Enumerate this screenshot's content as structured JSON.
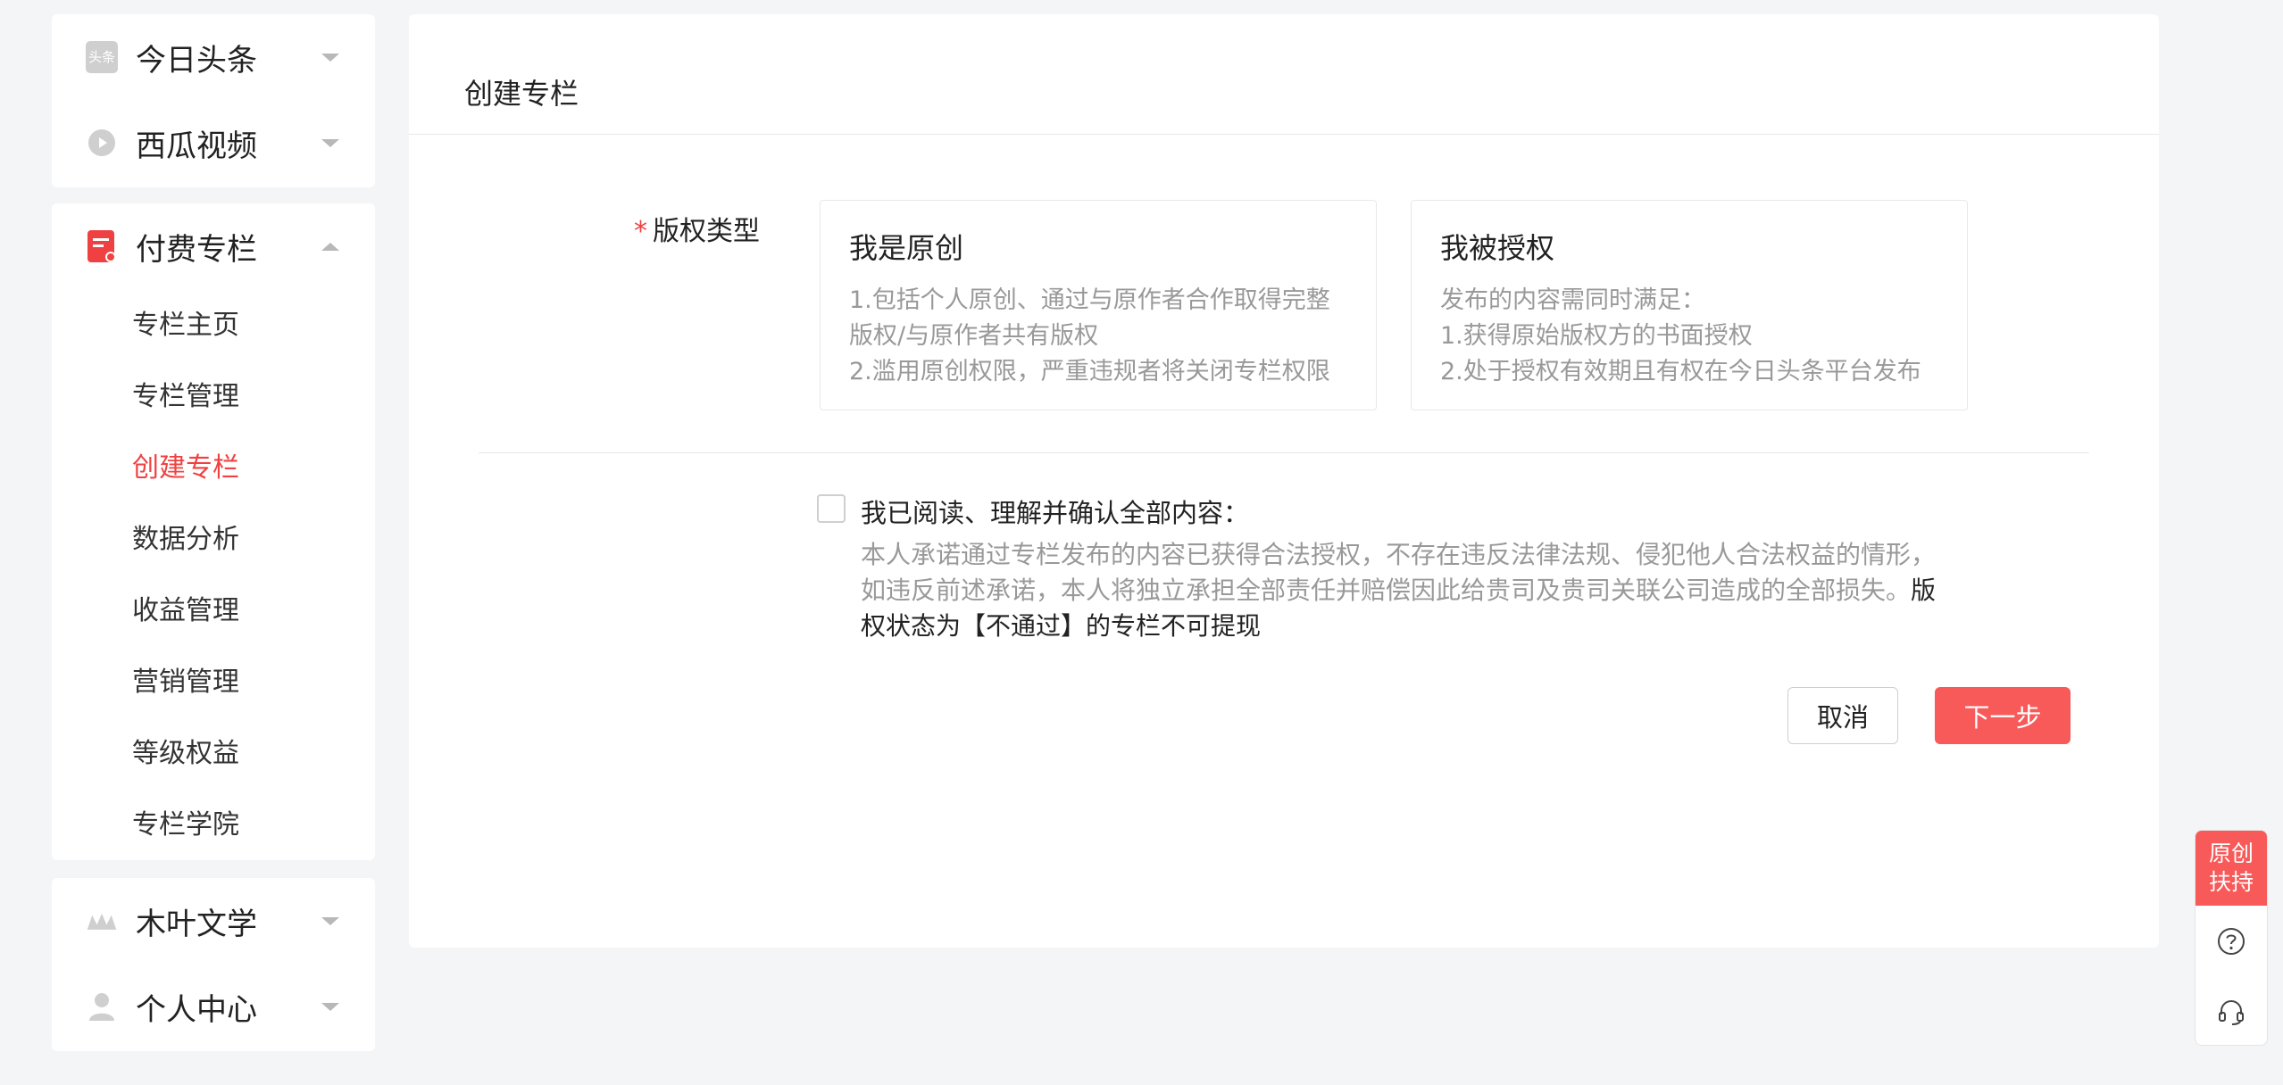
{
  "sidebar": {
    "toutiao": "今日头条",
    "xigua": "西瓜视频",
    "paid_column": {
      "label": "付费专栏",
      "items": [
        "专栏主页",
        "专栏管理",
        "创建专栏",
        "数据分析",
        "收益管理",
        "营销管理",
        "等级权益",
        "专栏学院"
      ],
      "active": "创建专栏"
    },
    "muye": "木叶文学",
    "personal": "个人中心",
    "toutiao_icon_text": "头条"
  },
  "main": {
    "title": "创建专栏",
    "copyright_label": "版权类型",
    "required_mark": "*",
    "options": [
      {
        "title": "我是原创",
        "lines": [
          "1.包括个人原创、通过与原作者合作取得完整",
          "版权/与原作者共有版权",
          "2.滥用原创权限，严重违规者将关闭专栏权限"
        ]
      },
      {
        "title": "我被授权",
        "lines": [
          "发布的内容需同时满足：",
          "1.获得原始版权方的书面授权",
          "2.处于授权有效期且有权在今日头条平台发布"
        ]
      }
    ],
    "agree_label": "我已阅读、理解并确认全部内容：",
    "agree_text": "本人承诺通过专栏发布的内容已获得合法授权，不存在违反法律法规、侵犯他人合法权益的情形，如违反前述承诺，本人将独立承担全部责任并赔偿因此给贵司及贵司关联公司造成的全部损失。",
    "agree_bold": "版权状态为【不通过】的专栏不可提现",
    "cancel": "取消",
    "next": "下一步"
  },
  "float": {
    "line1": "原创",
    "line2": "扶持"
  },
  "colors": {
    "accent": "#f04142",
    "button": "#f85959"
  }
}
